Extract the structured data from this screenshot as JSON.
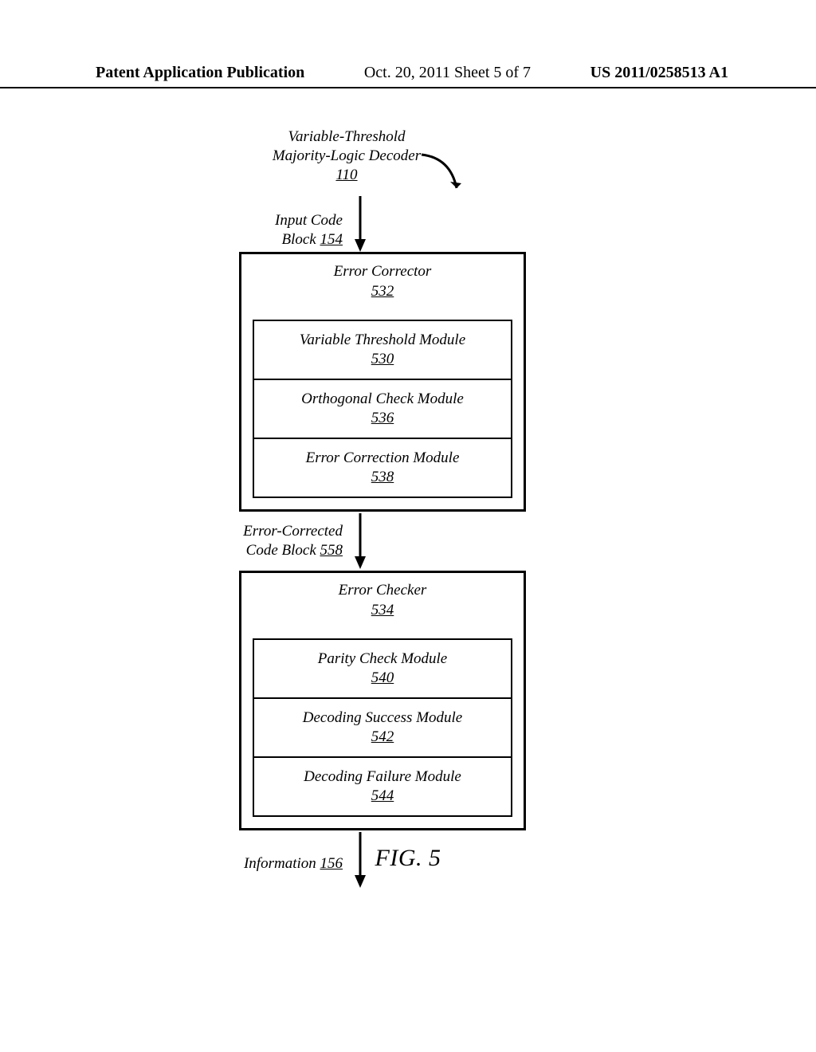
{
  "header": {
    "left": "Patent Application Publication",
    "center": "Oct. 20, 2011  Sheet 5 of 7",
    "right": "US 2011/0258513 A1"
  },
  "title": {
    "line1": "Variable-Threshold",
    "line2": "Majority-Logic Decoder",
    "ref": "110"
  },
  "input": {
    "line1": "Input Code",
    "line2_prefix": "Block ",
    "line2_ref": "154"
  },
  "corrector": {
    "title": "Error Corrector",
    "ref": "532",
    "modules": [
      {
        "name": "Variable Threshold Module",
        "ref": "530"
      },
      {
        "name": "Orthogonal Check Module",
        "ref": "536"
      },
      {
        "name": "Error Correction Module",
        "ref": "538"
      }
    ]
  },
  "mid": {
    "line1": "Error-Corrected",
    "line2_prefix": "Code Block ",
    "line2_ref": "558"
  },
  "checker": {
    "title": "Error Checker",
    "ref": "534",
    "modules": [
      {
        "name": "Parity Check Module",
        "ref": "540"
      },
      {
        "name": "Decoding Success Module",
        "ref": "542"
      },
      {
        "name": "Decoding Failure Module",
        "ref": "544"
      }
    ]
  },
  "output": {
    "prefix": "Information ",
    "ref": "156"
  },
  "figure": "FIG. 5"
}
